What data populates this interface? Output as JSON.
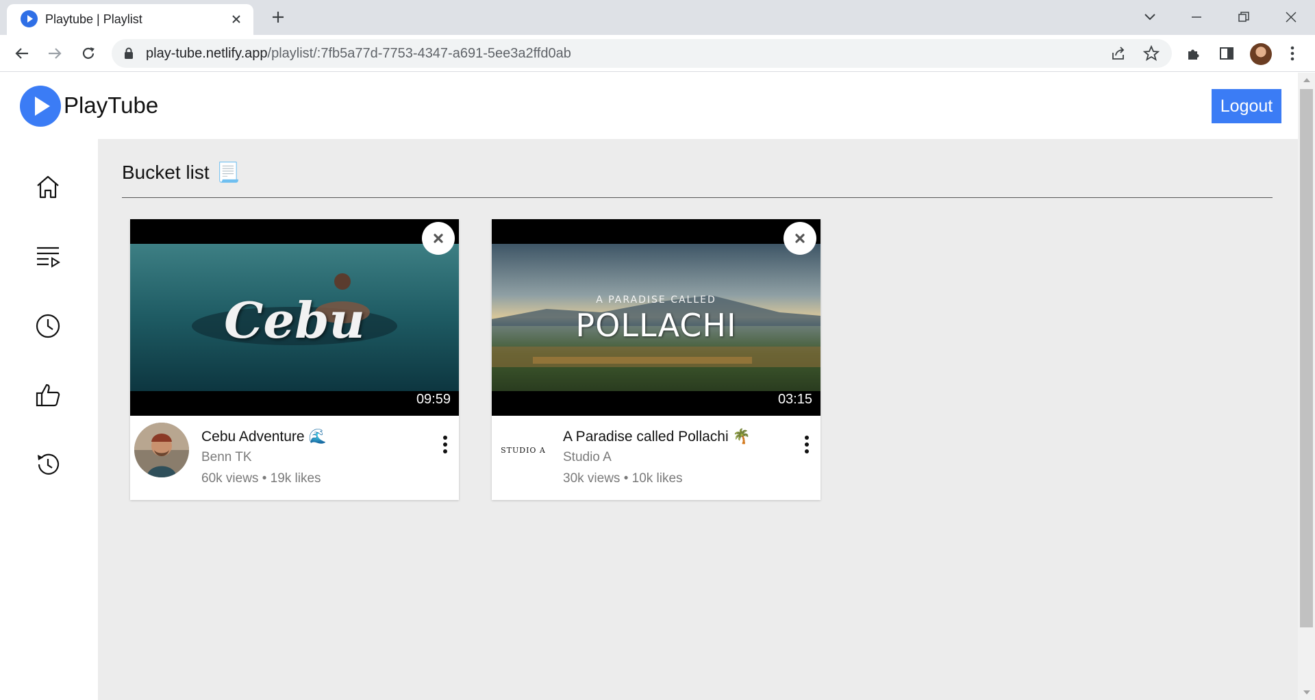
{
  "browser": {
    "tab_title": "Playtube | Playlist",
    "url_domain": "play-tube.netlify.app",
    "url_path": "/playlist/:7fb5a77d-7753-4347-a691-5ee3a2ffd0ab"
  },
  "app": {
    "logo_text": "PlayTube",
    "logout_label": "Logout",
    "accent_color": "#3b7cf5"
  },
  "sidebar": {
    "items": [
      {
        "icon": "home-icon"
      },
      {
        "icon": "playlist-icon"
      },
      {
        "icon": "watch-later-icon"
      },
      {
        "icon": "liked-icon"
      },
      {
        "icon": "history-icon"
      }
    ]
  },
  "playlist": {
    "title": "Bucket list",
    "title_emoji": "📃",
    "videos": [
      {
        "thumb_text": "Cebu",
        "duration": "09:59",
        "title": "Cebu Adventure 🌊",
        "channel": "Benn TK",
        "stats": "60k views • 19k likes"
      },
      {
        "thumb_text_small": "A PARADISE CALLED",
        "thumb_text": "POLLACHI",
        "duration": "03:15",
        "title": "A Paradise called Pollachi 🌴",
        "channel": "Studio A",
        "channel_logo_text": "STUDIO A",
        "stats": "30k views • 10k likes"
      }
    ]
  }
}
